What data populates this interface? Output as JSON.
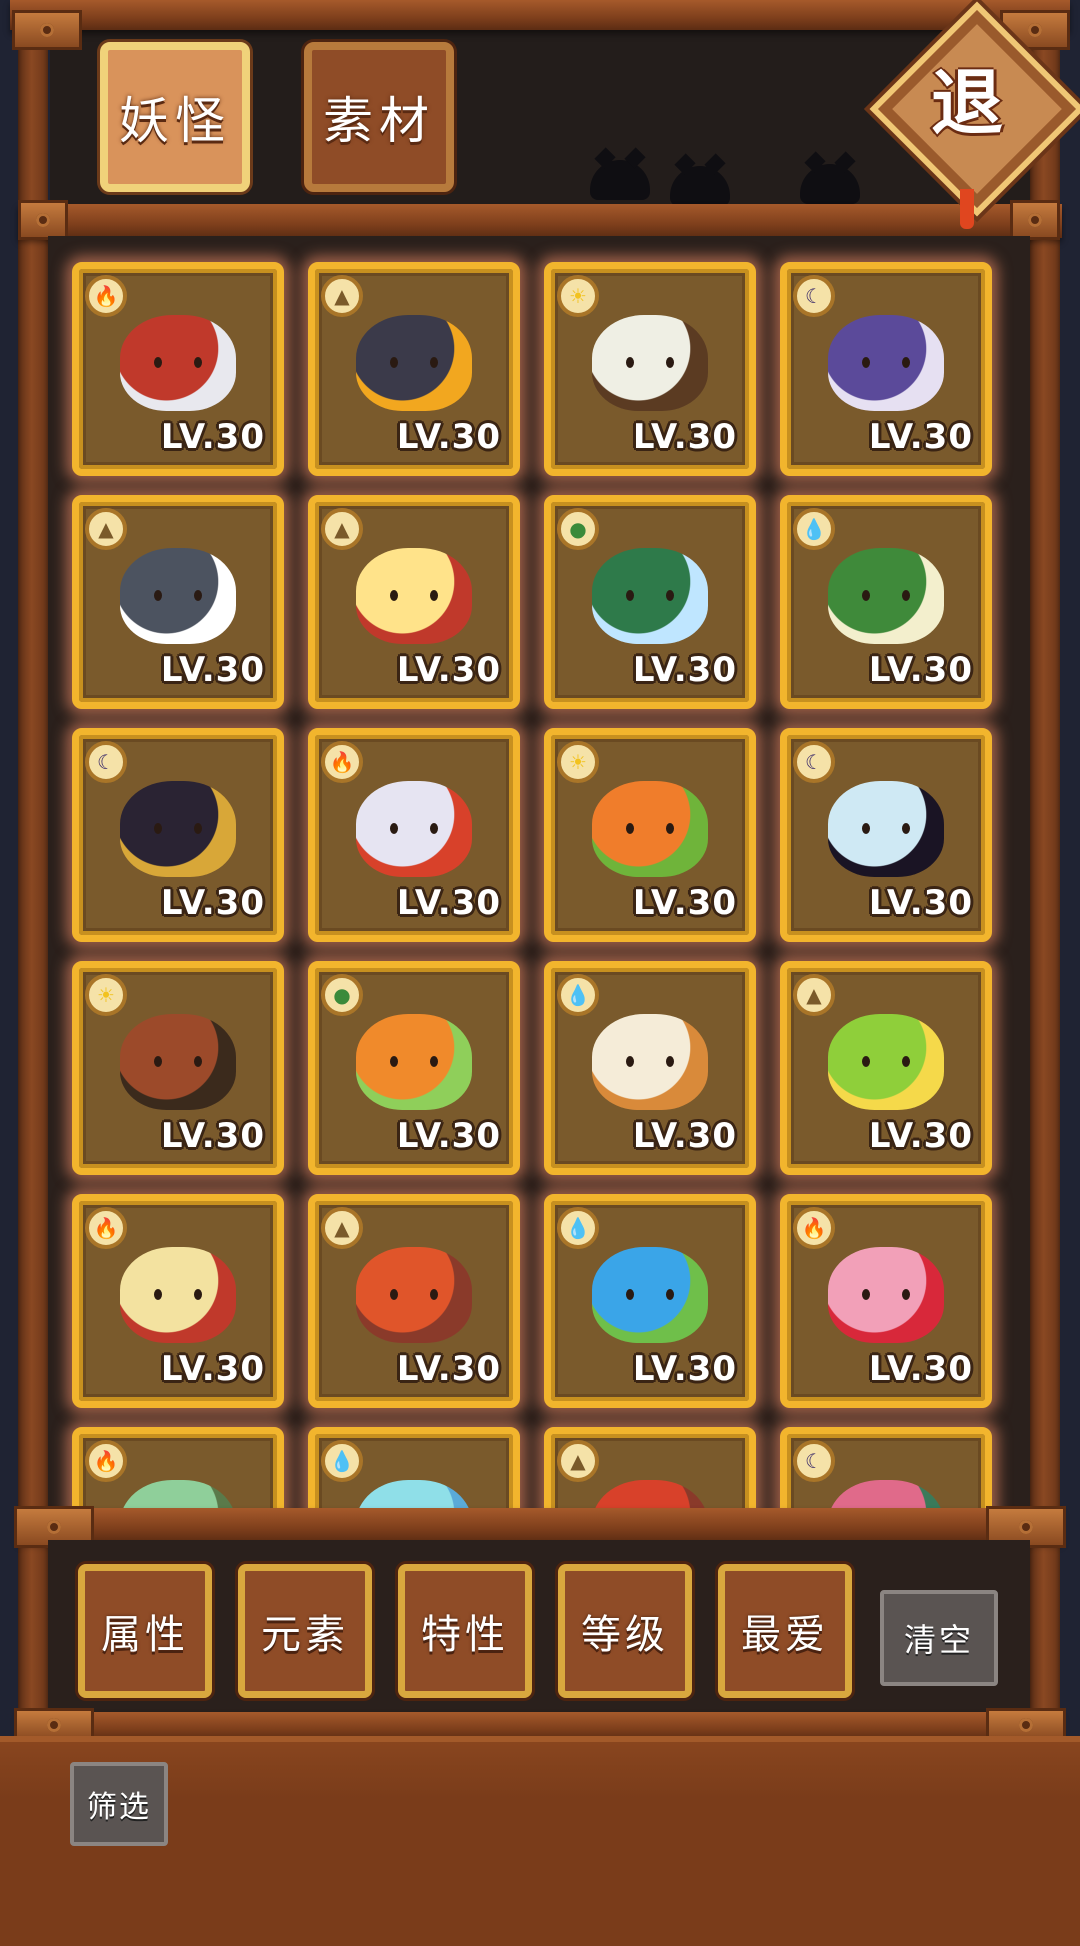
{
  "tabs": [
    {
      "label": "妖怪",
      "active": true
    },
    {
      "label": "素材",
      "active": false
    }
  ],
  "exit_button": {
    "label": "退"
  },
  "level_prefix": "LV.30",
  "cards": [
    {
      "element": "fire",
      "level": "LV.30",
      "colors": [
        "#c0392b",
        "#e8e8ee"
      ]
    },
    {
      "element": "earth",
      "level": "LV.30",
      "colors": [
        "#3b3a4a",
        "#f2a71f"
      ]
    },
    {
      "element": "light",
      "level": "LV.30",
      "colors": [
        "#efefe4",
        "#5b3b22"
      ]
    },
    {
      "element": "dark",
      "level": "LV.30",
      "colors": [
        "#5b4a9a",
        "#e6e0f2"
      ]
    },
    {
      "element": "earth",
      "level": "LV.30",
      "colors": [
        "#4c5360",
        "#ffffff"
      ]
    },
    {
      "element": "earth",
      "level": "LV.30",
      "colors": [
        "#ffe38a",
        "#c0392b"
      ]
    },
    {
      "element": "wood",
      "level": "LV.30",
      "colors": [
        "#2e7a4a",
        "#bfe6ff"
      ]
    },
    {
      "element": "water",
      "level": "LV.30",
      "colors": [
        "#3f8a3a",
        "#f3efcd"
      ]
    },
    {
      "element": "dark",
      "level": "LV.30",
      "colors": [
        "#2a2333",
        "#d8a738"
      ]
    },
    {
      "element": "fire",
      "level": "LV.30",
      "colors": [
        "#e6e4f2",
        "#d8412a"
      ]
    },
    {
      "element": "light",
      "level": "LV.30",
      "colors": [
        "#f07d2b",
        "#6fb43a"
      ]
    },
    {
      "element": "dark",
      "level": "LV.30",
      "colors": [
        "#cfe9f4",
        "#1a1424"
      ]
    },
    {
      "element": "light",
      "level": "LV.30",
      "colors": [
        "#9c4a2a",
        "#3b2a1c"
      ]
    },
    {
      "element": "wood",
      "level": "LV.30",
      "colors": [
        "#f08a2b",
        "#8fcf5a"
      ]
    },
    {
      "element": "water",
      "level": "LV.30",
      "colors": [
        "#f5ecd8",
        "#d98a3a"
      ]
    },
    {
      "element": "earth",
      "level": "LV.30",
      "colors": [
        "#8fcf3a",
        "#f5d94a"
      ]
    },
    {
      "element": "fire",
      "level": "LV.30",
      "colors": [
        "#f3e2a0",
        "#c0392b"
      ]
    },
    {
      "element": "earth",
      "level": "LV.30",
      "colors": [
        "#e0552a",
        "#8a3a2a"
      ]
    },
    {
      "element": "water",
      "level": "LV.30",
      "colors": [
        "#3aa5e8",
        "#6fbf4a"
      ]
    },
    {
      "element": "fire",
      "level": "LV.30",
      "colors": [
        "#f2a0b8",
        "#d8283a"
      ]
    },
    {
      "element": "fire",
      "level": "",
      "colors": [
        "#8fcf9a",
        "#5a7a4a"
      ]
    },
    {
      "element": "water",
      "level": "",
      "colors": [
        "#8fdfe8",
        "#5aaad8"
      ]
    },
    {
      "element": "earth",
      "level": "",
      "colors": [
        "#d8412a",
        "#8a3a2a"
      ]
    },
    {
      "element": "dark",
      "level": "",
      "colors": [
        "#e06a8a",
        "#3a7a5a"
      ]
    }
  ],
  "element_glyphs": {
    "fire": "🔥",
    "earth": "▲",
    "light": "☀",
    "dark": "☾",
    "wood": "●",
    "water": "💧"
  },
  "element_colors": {
    "fire": "#e0461f",
    "earth": "#7a5a2a",
    "light": "#f2c21f",
    "dark": "#3a2a6a",
    "wood": "#3a8a3a",
    "water": "#2a7ad8"
  },
  "filters": [
    "属性",
    "元素",
    "特性",
    "等级",
    "最爱"
  ],
  "clear_button": "清空",
  "screen_button": "筛选"
}
